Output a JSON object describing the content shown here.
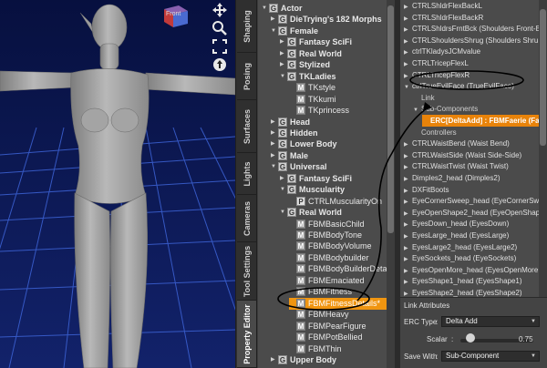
{
  "viewport": {
    "view_cube_label": "Front",
    "tools": [
      "move-icon",
      "zoom-icon",
      "frame-icon",
      "rotate-icon"
    ]
  },
  "side_tabs": [
    "Shaping",
    "Posing",
    "Surfaces",
    "Lights",
    "Cameras",
    "Tool Settings",
    "Property Editor"
  ],
  "tree": {
    "rows": [
      {
        "label": "Actor",
        "depth": 0,
        "arrow": "down",
        "icon": "G",
        "bold": true
      },
      {
        "label": "DieTrying's 182 Morphs",
        "depth": 1,
        "arrow": "right",
        "icon": "G",
        "bold": true
      },
      {
        "label": "Female",
        "depth": 1,
        "arrow": "down",
        "icon": "G",
        "bold": true
      },
      {
        "label": "Fantasy SciFi",
        "depth": 2,
        "arrow": "right",
        "icon": "G",
        "bold": true
      },
      {
        "label": "Real World",
        "depth": 2,
        "arrow": "right",
        "icon": "G",
        "bold": true
      },
      {
        "label": "Stylized",
        "depth": 2,
        "arrow": "right",
        "icon": "G",
        "bold": true
      },
      {
        "label": "TKLadies",
        "depth": 2,
        "arrow": "down",
        "icon": "G",
        "bold": true
      },
      {
        "label": "TKstyle",
        "depth": 3,
        "arrow": "",
        "icon": "M",
        "bold": false
      },
      {
        "label": "TKkumi",
        "depth": 3,
        "arrow": "",
        "icon": "M",
        "bold": false
      },
      {
        "label": "TKprincess",
        "depth": 3,
        "arrow": "",
        "icon": "M",
        "bold": false
      },
      {
        "label": "Head",
        "depth": 1,
        "arrow": "right",
        "icon": "G",
        "bold": true
      },
      {
        "label": "Hidden",
        "depth": 1,
        "arrow": "right",
        "icon": "G",
        "bold": true
      },
      {
        "label": "Lower Body",
        "depth": 1,
        "arrow": "right",
        "icon": "G",
        "bold": true
      },
      {
        "label": "Male",
        "depth": 1,
        "arrow": "right",
        "icon": "G",
        "bold": true
      },
      {
        "label": "Universal",
        "depth": 1,
        "arrow": "down",
        "icon": "G",
        "bold": true
      },
      {
        "label": "Fantasy SciFi",
        "depth": 2,
        "arrow": "right",
        "icon": "G",
        "bold": true
      },
      {
        "label": "Muscularity",
        "depth": 2,
        "arrow": "down",
        "icon": "G",
        "bold": true
      },
      {
        "label": "CTRLMuscularityOn",
        "depth": 3,
        "arrow": "",
        "icon": "P",
        "bold": false
      },
      {
        "label": "Real World",
        "depth": 2,
        "arrow": "down",
        "icon": "G",
        "bold": true
      },
      {
        "label": "FBMBasicChild",
        "depth": 3,
        "arrow": "",
        "icon": "M",
        "bold": false
      },
      {
        "label": "FBMBodyTone",
        "depth": 3,
        "arrow": "",
        "icon": "M",
        "bold": false
      },
      {
        "label": "FBMBodyVolume",
        "depth": 3,
        "arrow": "",
        "icon": "M",
        "bold": false
      },
      {
        "label": "FBMBodybuilder",
        "depth": 3,
        "arrow": "",
        "icon": "M",
        "bold": false
      },
      {
        "label": "FBMBodyBuilderDetails",
        "depth": 3,
        "arrow": "",
        "icon": "M",
        "bold": false
      },
      {
        "label": "FBMEmaciated",
        "depth": 3,
        "arrow": "",
        "icon": "M",
        "bold": false
      },
      {
        "label": "FBMFitness",
        "depth": 3,
        "arrow": "",
        "icon": "M",
        "bold": false
      },
      {
        "label": "FBMFitnessDetails*",
        "depth": 3,
        "arrow": "",
        "icon": "M",
        "bold": false,
        "selected": true
      },
      {
        "label": "FBMHeavy",
        "depth": 3,
        "arrow": "",
        "icon": "M",
        "bold": false
      },
      {
        "label": "FBMPearFigure",
        "depth": 3,
        "arrow": "",
        "icon": "M",
        "bold": false
      },
      {
        "label": "FBMPotBellied",
        "depth": 3,
        "arrow": "",
        "icon": "M",
        "bold": false
      },
      {
        "label": "FBMThin",
        "depth": 3,
        "arrow": "",
        "icon": "M",
        "bold": false
      },
      {
        "label": "Upper Body",
        "depth": 1,
        "arrow": "right",
        "icon": "G",
        "bold": true
      }
    ]
  },
  "properties": {
    "rows": [
      {
        "text": "CTRLShldrFlexBackL",
        "arrow": "right"
      },
      {
        "text": "CTRLShldrFlexBackR",
        "arrow": "right"
      },
      {
        "text": "CTRLShldrsFrntBck (Shoulders Front-B",
        "arrow": "right"
      },
      {
        "text": "CTRLShouldersShrug (Shoulders Shru",
        "arrow": "right"
      },
      {
        "text": "ctrlTKladysJCMvalue",
        "arrow": "right"
      },
      {
        "text": "CTRLTricepFlexL",
        "arrow": "right"
      },
      {
        "text": "CTRLTricepFlexR",
        "arrow": "right"
      },
      {
        "text": "ctrlTrueEvilFace (TrueEvilFace)",
        "arrow": "down"
      },
      {
        "text": "Link",
        "arrow": "",
        "indent": 1,
        "sub": true
      },
      {
        "text": "Sub-Components",
        "arrow": "down",
        "indent": 1,
        "sub": true
      },
      {
        "text": "ERC[DeltaAdd] : FBMFaerie (Faeri",
        "arrow": "",
        "indent": 2,
        "highlight": true
      },
      {
        "text": "Controllers",
        "arrow": "",
        "indent": 1,
        "sub": true
      },
      {
        "text": "CTRLWaistBend (Waist Bend)",
        "arrow": "right"
      },
      {
        "text": "CTRLWaistSide (Waist Side-Side)",
        "arrow": "right"
      },
      {
        "text": "CTRLWaistTwist (Waist Twist)",
        "arrow": "right"
      },
      {
        "text": "Dimples2_head (Dimples2)",
        "arrow": "right"
      },
      {
        "text": "DXFitBoots",
        "arrow": "right"
      },
      {
        "text": "EyeCornerSweep_head (EyeCornerSwe",
        "arrow": "right"
      },
      {
        "text": "EyeOpenShape2_head (EyeOpenShap",
        "arrow": "right"
      },
      {
        "text": "EyesDown_head (EyesDown)",
        "arrow": "right"
      },
      {
        "text": "EyesLarge_head (EyesLarge)",
        "arrow": "right"
      },
      {
        "text": "EyesLarge2_head (EyesLarge2)",
        "arrow": "right"
      },
      {
        "text": "EyeSockets_head (EyeSockets)",
        "arrow": "right"
      },
      {
        "text": "EyesOpenMore_head (EyesOpenMore",
        "arrow": "right"
      },
      {
        "text": "EyesShape1_head (EyesShape1)",
        "arrow": "right"
      },
      {
        "text": "EyesShape2_head (EyesShape2)",
        "arrow": "right"
      }
    ]
  },
  "link_attributes": {
    "title": "Link Attributes",
    "erc_type_label": "ERC Type",
    "erc_type_value": "Delta Add",
    "scalar_label": "Scalar",
    "scalar_value": "0.75",
    "save_with_label": "Save With",
    "save_with_value": "Sub-Component"
  }
}
